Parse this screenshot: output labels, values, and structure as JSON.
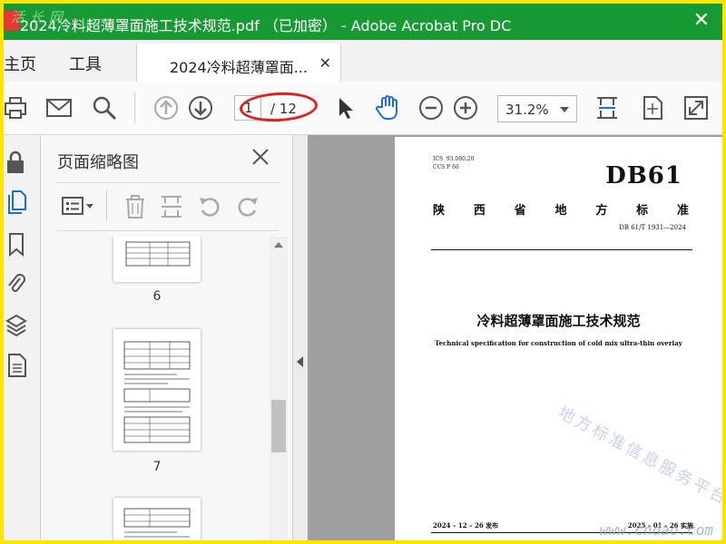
{
  "window": {
    "title": "2024冷料超薄罩面施工技术规范.pdf （已加密） - Adobe Acrobat Pro DC",
    "title_watermark": "活长网",
    "close_symbol": "✕"
  },
  "tabs": {
    "home": "主页",
    "tools": "工具",
    "document": "2024冷料超薄罩面...",
    "document_close": "✕"
  },
  "toolbar": {
    "current_page": "1",
    "total_pages": "/ 12",
    "zoom": "31.2%"
  },
  "thumbnail_panel": {
    "title": "页面缩略图",
    "pages": [
      {
        "label": "6"
      },
      {
        "label": "7"
      }
    ]
  },
  "document": {
    "ics": "ICS  93.080.20\nCCS P 66",
    "code": "DB61",
    "province_chars": [
      "陕",
      "西",
      "省",
      "地",
      "方",
      "标",
      "准"
    ],
    "standard_number": "DB 61/T  1931—2024",
    "title": "冷料超薄罩面施工技术规范",
    "subtitle": "Technical specification for construction of cold mix ultra-thin overlay",
    "publish_date": "2024 – 12 – 26 发布",
    "implement_date": "2025 – 01 – 26 实施",
    "watermark": "地方标准信息服务平台",
    "corner_watermark": "www.cndao.com"
  },
  "colors": {
    "titlebar": "#179a33",
    "frame": "#ffe400",
    "annotation": "#e02020",
    "hand_tool": "#1a6fd1"
  }
}
